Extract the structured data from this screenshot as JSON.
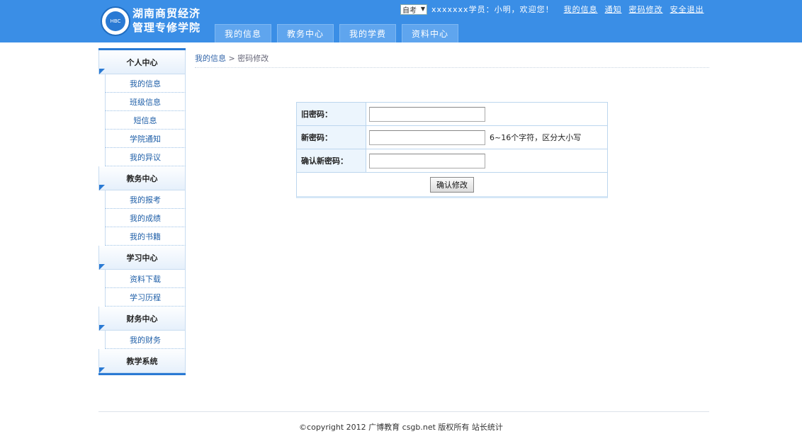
{
  "header": {
    "logo_line1": "湖南商贸经济",
    "logo_line2": "管理专修学院",
    "exam_type": "自考",
    "welcome": "xxxxxxx学员：小明，欢迎您！",
    "links": [
      "我的信息",
      "通知",
      "密码修改",
      "安全退出"
    ],
    "tabs": [
      "我的信息",
      "教务中心",
      "我的学费",
      "资料中心"
    ]
  },
  "sidebar": {
    "sections": [
      {
        "title": "个人中心",
        "items": [
          "我的信息",
          "班级信息",
          "短信息",
          "学院通知",
          "我的异议"
        ]
      },
      {
        "title": "教务中心",
        "items": [
          "我的报考",
          "我的成绩",
          "我的书籍"
        ]
      },
      {
        "title": "学习中心",
        "items": [
          "资料下载",
          "学习历程"
        ]
      },
      {
        "title": "财务中心",
        "items": [
          "我的财务"
        ]
      },
      {
        "title": "教学系统",
        "items": []
      }
    ]
  },
  "breadcrumb": {
    "parent": "我的信息",
    "separator": " > ",
    "current": "密码修改"
  },
  "form": {
    "old_password_label": "旧密码：",
    "new_password_label": "新密码：",
    "new_password_hint": "6~16个字符，区分大小写",
    "confirm_password_label": "确认新密码：",
    "submit_label": "确认修改"
  },
  "footer": {
    "text": "©copyright 2012 广博教育 csgb.net 版权所有 站长统计"
  },
  "colors": {
    "header_bg": "#3a8ee6",
    "accent": "#2a7ad4"
  }
}
